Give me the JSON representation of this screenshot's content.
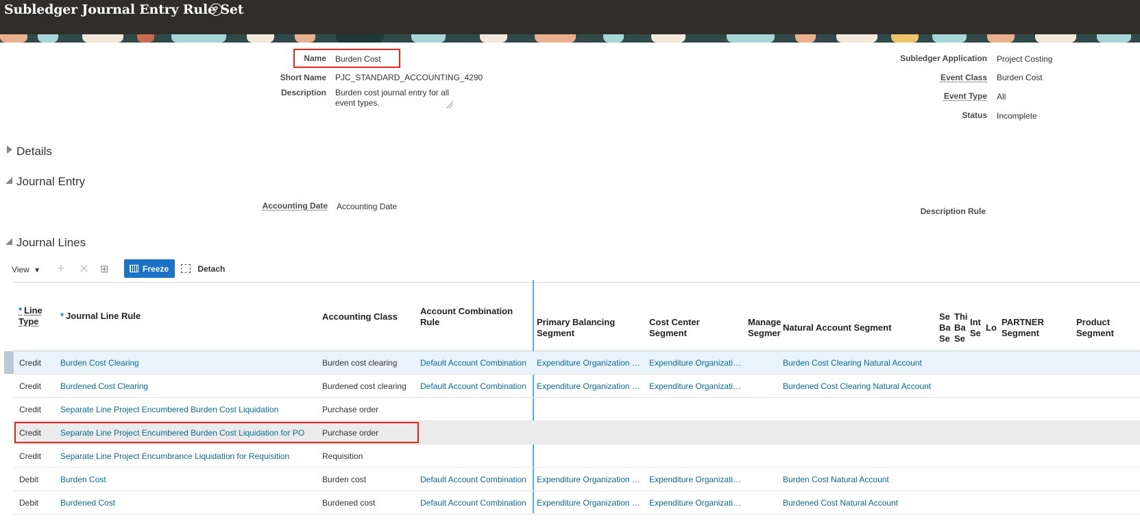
{
  "header": {
    "title": "Subledger Journal Entry Rule Set",
    "help_icon": "question-circle-icon"
  },
  "form": {
    "name_label": "Name",
    "name_value": "Burden Cost",
    "short_name_label": "Short Name",
    "short_name_value": "PJC_STANDARD_ACCOUNTING_4290",
    "description_label": "Description",
    "description_value": "Burden cost journal entry for all event types.",
    "subledger_application_label": "Subledger Application",
    "subledger_application_value": "Project Costing",
    "event_class_label": "Event Class",
    "event_class_value": "Burden Cost",
    "event_type_label": "Event Type",
    "event_type_value": "All",
    "status_label": "Status",
    "status_value": "Incomplete"
  },
  "sections": {
    "details": "Details",
    "journal_entry": "Journal Entry",
    "journal_lines": "Journal Lines"
  },
  "journal_entry": {
    "accounting_date_label": "Accounting Date",
    "accounting_date_value": "Accounting Date",
    "description_rule_label": "Description Rule"
  },
  "toolbar": {
    "view": "View",
    "freeze": "Freeze",
    "detach": "Detach"
  },
  "table": {
    "headers": {
      "line_type_1": "Line",
      "line_type_2": "Type",
      "journal_line_rule": "Journal Line Rule",
      "accounting_class": "Accounting Class",
      "account_combination_rule_1": "Account Combination",
      "account_combination_rule_2": "Rule",
      "primary_balancing_1": "Primary Balancing",
      "primary_balancing_2": "Segment",
      "cost_center_1": "Cost Center",
      "cost_center_2": "Segment",
      "management_1": "Manage",
      "management_2": "Segmer",
      "natural_account": "Natural Account Segment",
      "second_balancing_1": "Se",
      "second_balancing_2": "Ba",
      "second_balancing_3": "Se",
      "third_balancing_1": "Thi",
      "third_balancing_2": "Ba",
      "third_balancing_3": "Se",
      "intercompany_1": "Int",
      "intercompany_2": "Se",
      "location": "Lo",
      "partner_1": "PARTNER",
      "partner_2": "Segment",
      "product_1": "Product",
      "product_2": "Segment"
    },
    "rows": [
      {
        "line_type": "Credit",
        "journal_line_rule": "Burden Cost Clearing",
        "accounting_class": "Burden cost clearing",
        "account_combination_rule": "Default Account Combination",
        "primary_balancing": "Expenditure Organization Cost Center",
        "cost_center": "Expenditure Organization Cost Center",
        "natural_account": "Burden Cost Clearing Natural Account"
      },
      {
        "line_type": "Credit",
        "journal_line_rule": "Burdened Cost Clearing",
        "accounting_class": "Burdened cost clearing",
        "account_combination_rule": "Default Account Combination",
        "primary_balancing": "Expenditure Organization Cost Center",
        "cost_center": "Expenditure Organization Cost Center",
        "natural_account": "Burdened Cost Clearing Natural Account"
      },
      {
        "line_type": "Credit",
        "journal_line_rule": "Separate Line Project Encumbered Burden Cost Liquidation",
        "accounting_class": "Purchase order",
        "account_combination_rule": "",
        "primary_balancing": "",
        "cost_center": "",
        "natural_account": ""
      },
      {
        "line_type": "Credit",
        "journal_line_rule": "Separate Line Project Encumbered Burden Cost Liquidation for PO",
        "accounting_class": "Purchase order",
        "account_combination_rule": "",
        "primary_balancing": "",
        "cost_center": "",
        "natural_account": ""
      },
      {
        "line_type": "Credit",
        "journal_line_rule": "Separate Line Project Encumbrance Liquidation for Requisition",
        "accounting_class": "Requisition",
        "account_combination_rule": "",
        "primary_balancing": "",
        "cost_center": "",
        "natural_account": ""
      },
      {
        "line_type": "Debit",
        "journal_line_rule": "Burden Cost",
        "accounting_class": "Burden cost",
        "account_combination_rule": "Default Account Combination",
        "primary_balancing": "Expenditure Organization Cost Center",
        "cost_center": "Expenditure Organization Cost Center",
        "natural_account": "Burden Cost Natural Account"
      },
      {
        "line_type": "Debit",
        "journal_line_rule": "Burdened Cost",
        "accounting_class": "Burdened cost",
        "account_combination_rule": "Default Account Combination",
        "primary_balancing": "Expenditure Organization Cost Center",
        "cost_center": "Expenditure Organization Cost Center",
        "natural_account": "Burdened Cost Natural Account"
      }
    ]
  },
  "colors": {
    "header_bg": "#312d2a",
    "link": "#0b6b9a",
    "freeze_bg": "#1a73c7",
    "highlight_box": "#e0261b",
    "selected_row": "#e8f3fb",
    "hover_row": "#ebebeb"
  }
}
